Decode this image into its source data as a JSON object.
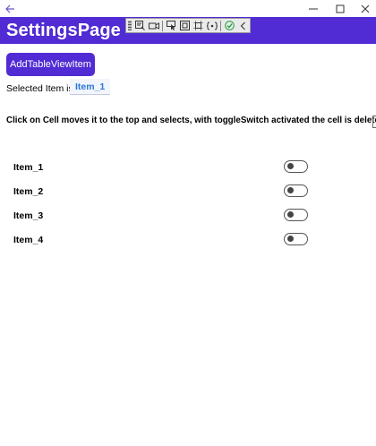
{
  "window": {
    "back_icon": "arrow-left-icon",
    "controls": [
      "minimize-icon",
      "maximize-icon",
      "close-icon"
    ]
  },
  "header": {
    "title": "SettingsPage",
    "background": "#512bd4"
  },
  "debug_toolbar": {
    "tools": [
      "live-visual-tree-icon",
      "video-icon",
      "select-element-icon",
      "display-layout-adorners-icon",
      "track-focus-icon",
      "binding-failures-icon",
      "hot-reload-ok-icon",
      "collapse-chevron-icon"
    ]
  },
  "actions": {
    "add_label": "AddTableViewItem",
    "accent": "#512bd4"
  },
  "selection": {
    "label": "Selected Item is:",
    "value": "Item_1"
  },
  "instruction": "Click on Cell moves it to the top and selects, with toggleSwitch activated the cell is deleted",
  "items": [
    {
      "label": "Item_1",
      "toggle_on": false
    },
    {
      "label": "Item_2",
      "toggle_on": false
    },
    {
      "label": "Item_3",
      "toggle_on": false
    },
    {
      "label": "Item_4",
      "toggle_on": false
    }
  ]
}
